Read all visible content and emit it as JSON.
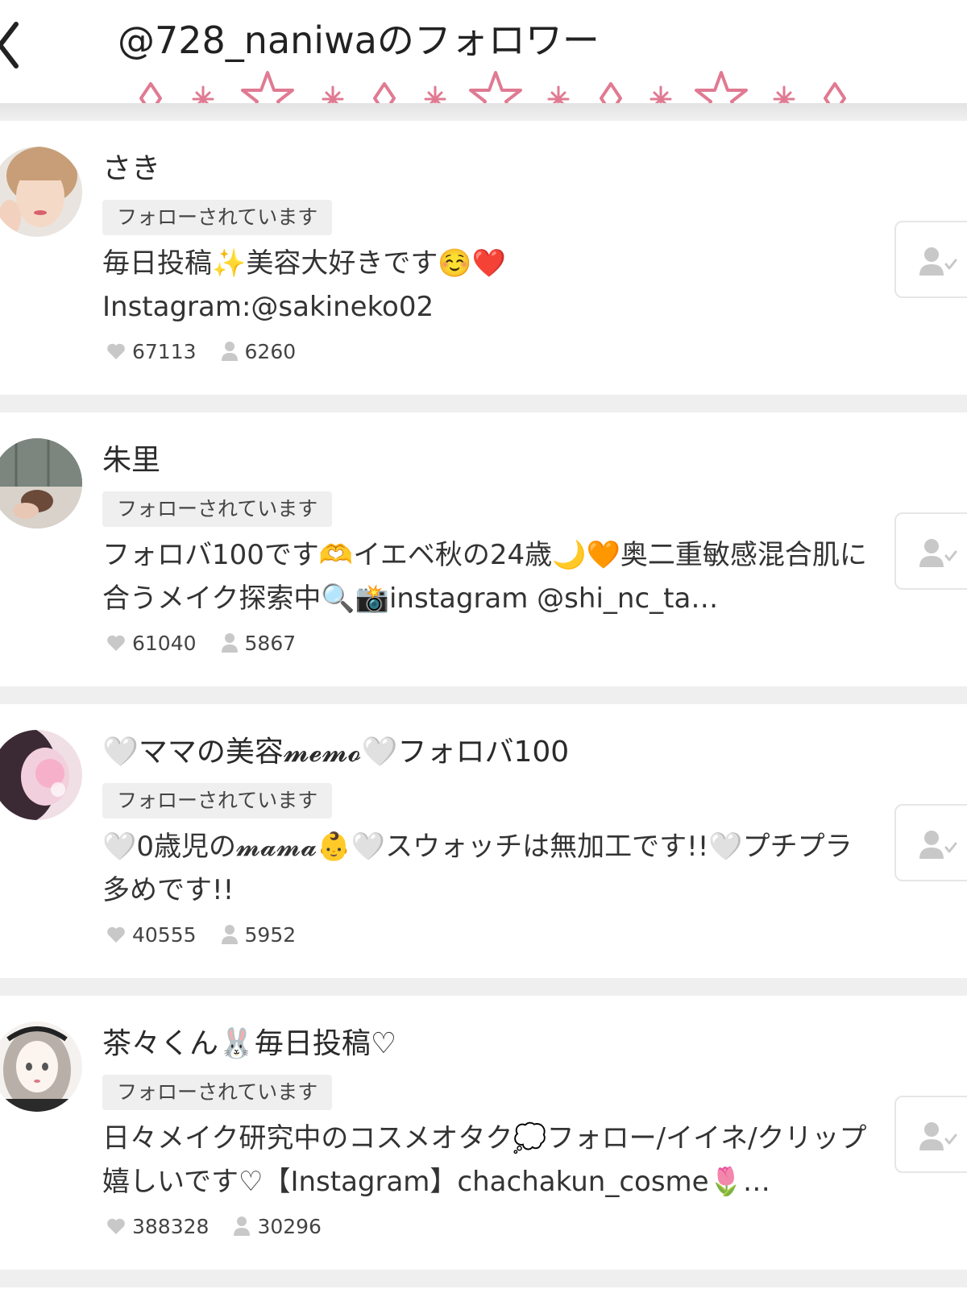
{
  "header": {
    "title": "@728_naniwaのフォロワー"
  },
  "followers": [
    {
      "name": "さき",
      "badge": "フォローされています",
      "bio": "毎日投稿✨美容大好きです☺️❤️\nInstagram:@sakineko02",
      "likes": "67113",
      "followers": "6260"
    },
    {
      "name": "朱里",
      "badge": "フォローされています",
      "bio": "フォロバ100です🫶イエベ秋の24歳🌙🧡奥二重敏感混合肌に合うメイク探索中🔍📸instagram @shi_nc_ta…",
      "likes": "61040",
      "followers": "5867"
    },
    {
      "name": "🤍ママの美容𝓶𝓮𝓶𝓸🤍フォロバ100",
      "badge": "フォローされています",
      "bio": "🤍0歳児の𝓶𝓪𝓶𝓪👶🤍スウォッチは無加工です!!🤍プチプラ多めです!!",
      "likes": "40555",
      "followers": "5952"
    },
    {
      "name": "茶々くん🐰毎日投稿♡",
      "badge": "フォローされています",
      "bio": "日々メイク研究中のコスメオタク💭フォロー/イイネ/クリップ嬉しいです♡【Instagram】chachakun_cosme🌷…",
      "likes": "388328",
      "followers": "30296"
    }
  ],
  "colors": {
    "decoration": "#e07a92",
    "divider": "#efefef",
    "badge_bg": "#efefef",
    "icon_gray": "#c8c8c8"
  }
}
